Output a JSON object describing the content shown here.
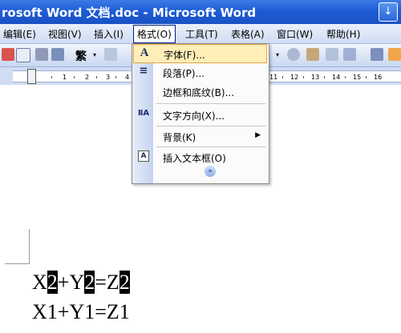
{
  "window": {
    "title": "rosoft Word 文档.doc - Microsoft Word",
    "control_glyph": "↓"
  },
  "menubar": {
    "items": [
      {
        "label": "编辑(E)"
      },
      {
        "label": "视图(V)"
      },
      {
        "label": "插入(I)"
      },
      {
        "label": "格式(O)"
      },
      {
        "label": "工具(T)"
      },
      {
        "label": "表格(A)"
      },
      {
        "label": "窗口(W)"
      },
      {
        "label": "帮助(H)"
      }
    ]
  },
  "toolbar": {
    "traditional_label": "繁"
  },
  "ruler": {
    "numbers": [
      "1",
      "2",
      "3",
      "4",
      "11",
      "12",
      "13",
      "14",
      "15",
      "16"
    ]
  },
  "format_menu": {
    "items": [
      {
        "label": "字体(F)...",
        "icon": "A"
      },
      {
        "label": "段落(P)...",
        "icon": "≡"
      },
      {
        "label": "边框和底纹(B)...",
        "icon": ""
      },
      {
        "label": "文字方向(X)...",
        "icon": "ⅡA"
      },
      {
        "label": "背景(K)",
        "icon": ""
      },
      {
        "label": "插入文本框(O)",
        "icon": "A"
      }
    ],
    "expand_glyph": "»"
  },
  "document": {
    "line1": {
      "a": "X",
      "b": "2",
      "c": "+Y",
      "d": "2",
      "e": "=Z",
      "f": "2"
    },
    "line2": "X1+Y1=Z1"
  }
}
